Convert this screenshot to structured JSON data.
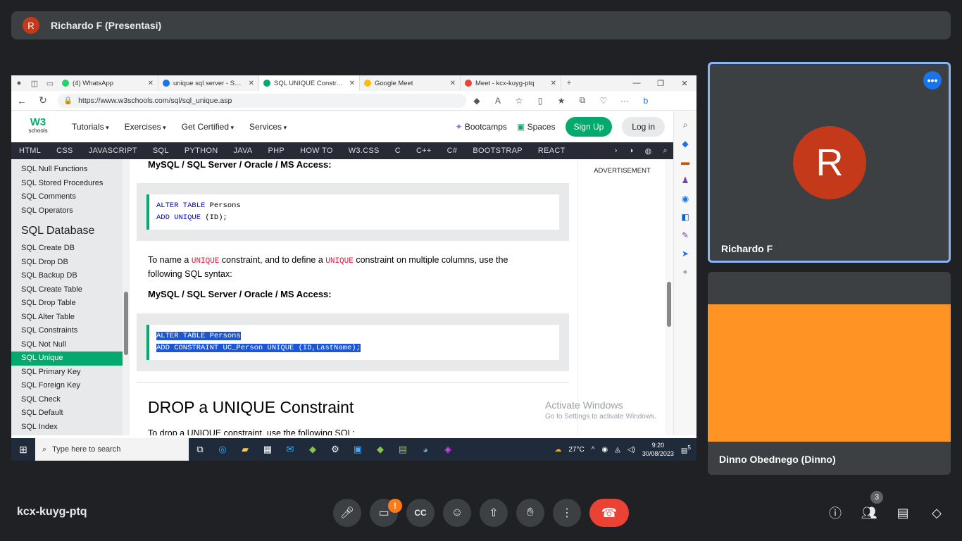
{
  "meet": {
    "presenter_initial": "R",
    "banner_title": "Richardo F (Presentasi)",
    "meeting_code": "kcx-kuyg-ptq",
    "participant_count": "3",
    "alert_badge": "!",
    "participants": [
      {
        "initial": "R",
        "name": "Richardo F",
        "color": "#c5391b"
      },
      {
        "name": "Dinno Obednego (Dinno)",
        "video_color": "#ff9424"
      }
    ],
    "controls": [
      "mic-icon",
      "camera-off-icon",
      "captions-icon",
      "emoji-icon",
      "present-icon",
      "raise-hand-icon",
      "more-options-icon",
      "end-call-icon"
    ],
    "right_controls": [
      "info-icon",
      "people-icon",
      "chat-icon",
      "activities-icon"
    ]
  },
  "browser": {
    "tabs": [
      {
        "title": "(4) WhatsApp",
        "color": "#25d366"
      },
      {
        "title": "unique sql server - Search",
        "color": "#1a73e8"
      },
      {
        "title": "SQL UNIQUE Constraint",
        "color": "#04aa6d",
        "active": true
      },
      {
        "title": "Google Meet",
        "color": "#fbbc04"
      },
      {
        "title": "Meet - kcx-kuyg-ptq",
        "color": "#ea4335"
      }
    ],
    "url": "https://www.w3schools.com/sql/sql_unique.asp"
  },
  "w3": {
    "logo": "W3",
    "logo_sub": "schools",
    "menu": [
      "Tutorials",
      "Exercises",
      "Get Certified",
      "Services"
    ],
    "bootcamps": "Bootcamps",
    "spaces": "Spaces",
    "signup": "Sign Up",
    "login": "Log in",
    "topnav": [
      "HTML",
      "CSS",
      "JAVASCRIPT",
      "SQL",
      "PYTHON",
      "JAVA",
      "PHP",
      "HOW TO",
      "W3.CSS",
      "C",
      "C++",
      "C#",
      "BOOTSTRAP",
      "REACT"
    ],
    "sidebar_top": [
      "SQL Null Functions",
      "SQL Stored Procedures",
      "SQL Comments",
      "SQL Operators"
    ],
    "sidebar_heading": "SQL Database",
    "sidebar_db": [
      "SQL Create DB",
      "SQL Drop DB",
      "SQL Backup DB",
      "SQL Create Table",
      "SQL Drop Table",
      "SQL Alter Table",
      "SQL Constraints",
      "SQL Not Null",
      "SQL Unique",
      "SQL Primary Key",
      "SQL Foreign Key",
      "SQL Check",
      "SQL Default",
      "SQL Index"
    ],
    "active_item": "SQL Unique",
    "heading1": "MySQL / SQL Server / Oracle / MS Access:",
    "code1_line1_kw": "ALTER TABLE",
    "code1_line1_rest": " Persons",
    "code1_line2_kw": "ADD UNIQUE",
    "code1_line2_rest": " (ID);",
    "para_1": "To name a ",
    "para_kw": "UNIQUE",
    "para_2": " constraint, and to define a ",
    "para_3": " constraint on multiple columns, use the following SQL syntax:",
    "heading2": "MySQL / SQL Server / Oracle / MS Access:",
    "code2_line1": "ALTER TABLE Persons",
    "code2_line2": "ADD CONSTRAINT UC_Person UNIQUE (ID,LastName);",
    "section_title": "DROP a UNIQUE Constraint",
    "next_para": "To drop a UNIQUE constraint, use the following SQL:",
    "advertisement": "ADVERTISEMENT"
  },
  "windows": {
    "activate_title": "Activate Windows",
    "activate_sub": "Go to Settings to activate Windows.",
    "search_placeholder": "Type here to search",
    "temperature": "27°C",
    "time": "9:20",
    "date": "30/08/2023",
    "notif_count": "5"
  }
}
